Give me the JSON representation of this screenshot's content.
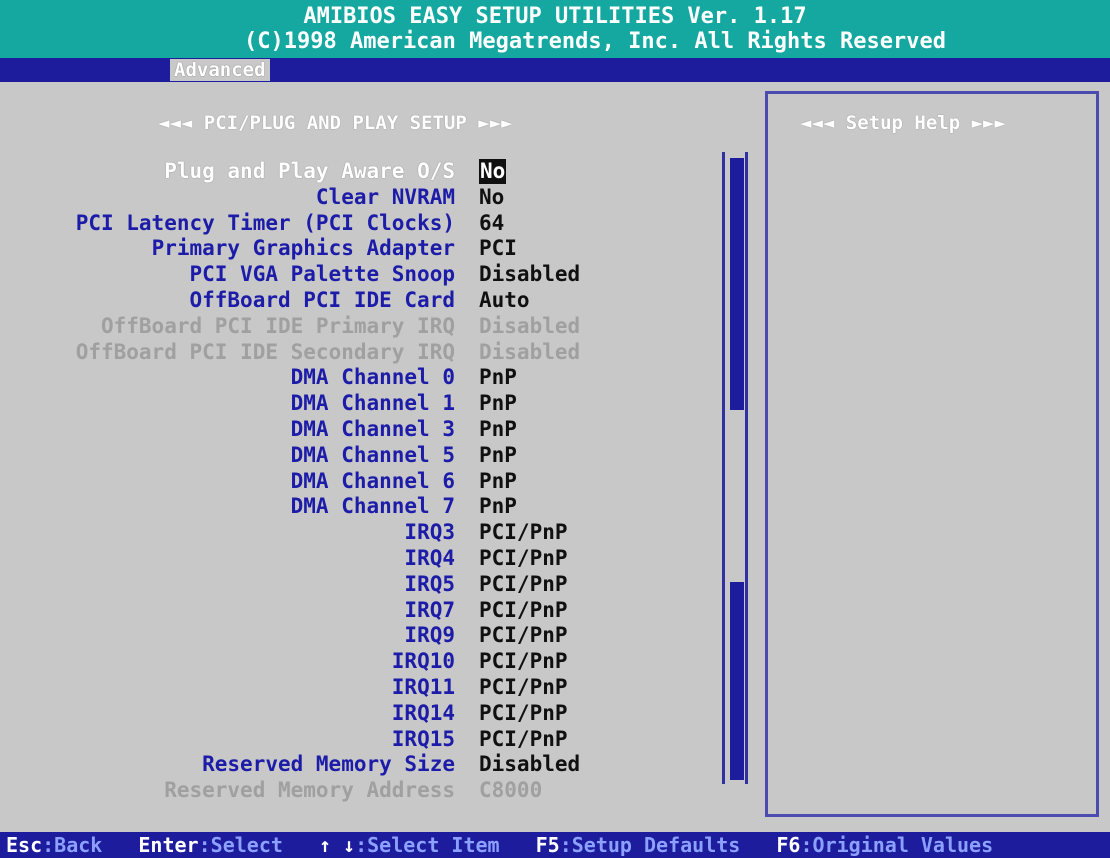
{
  "header": {
    "line1": "AMIBIOS EASY SETUP UTILITIES Ver. 1.17",
    "line2": "(C)1998 American Megatrends, Inc. All Rights Reserved"
  },
  "menu": {
    "active_tab": "Advanced"
  },
  "panel": {
    "title": "◄◄◄ PCI/PLUG AND PLAY SETUP ►►►"
  },
  "help": {
    "title": "◄◄◄ Setup Help ►►►"
  },
  "settings": [
    {
      "label": "Plug and Play Aware O/S",
      "value": "No"
    },
    {
      "label": "Clear NVRAM",
      "value": "No"
    },
    {
      "label": "PCI Latency Timer (PCI Clocks)",
      "value": "64"
    },
    {
      "label": "Primary Graphics Adapter",
      "value": "PCI"
    },
    {
      "label": "PCI VGA Palette Snoop",
      "value": "Disabled"
    },
    {
      "label": "OffBoard PCI IDE Card",
      "value": "Auto"
    },
    {
      "label": "OffBoard PCI IDE Primary IRQ",
      "value": "Disabled"
    },
    {
      "label": "OffBoard PCI IDE Secondary IRQ",
      "value": "Disabled"
    },
    {
      "label": "DMA Channel 0",
      "value": "PnP"
    },
    {
      "label": "DMA Channel 1",
      "value": "PnP"
    },
    {
      "label": "DMA Channel 3",
      "value": "PnP"
    },
    {
      "label": "DMA Channel 5",
      "value": "PnP"
    },
    {
      "label": "DMA Channel 6",
      "value": "PnP"
    },
    {
      "label": "DMA Channel 7",
      "value": "PnP"
    },
    {
      "label": "IRQ3",
      "value": "PCI/PnP"
    },
    {
      "label": "IRQ4",
      "value": "PCI/PnP"
    },
    {
      "label": "IRQ5",
      "value": "PCI/PnP"
    },
    {
      "label": "IRQ7",
      "value": "PCI/PnP"
    },
    {
      "label": "IRQ9",
      "value": "PCI/PnP"
    },
    {
      "label": "IRQ10",
      "value": "PCI/PnP"
    },
    {
      "label": "IRQ11",
      "value": "PCI/PnP"
    },
    {
      "label": "IRQ14",
      "value": "PCI/PnP"
    },
    {
      "label": "IRQ15",
      "value": "PCI/PnP"
    },
    {
      "label": "Reserved Memory Size",
      "value": "Disabled"
    },
    {
      "label": "Reserved Memory Address",
      "value": "C8000"
    }
  ],
  "footer": {
    "esc_key": "Esc",
    "esc_label": ":Back",
    "enter_key": "Enter",
    "enter_label": ":Select",
    "arrows_key": "↑ ↓",
    "arrows_label": ":Select Item",
    "f5_key": "F5",
    "f5_label": ":Setup Defaults",
    "f6_key": "F6",
    "f6_label": ":Original Values"
  },
  "colors": {
    "header_bg": "#14a8a0",
    "menubar_bg": "#1c1c9c",
    "panel_bg": "#c8c8c8",
    "label_blue": "#1c1ca8",
    "disabled_grey": "#a0a0a0"
  }
}
